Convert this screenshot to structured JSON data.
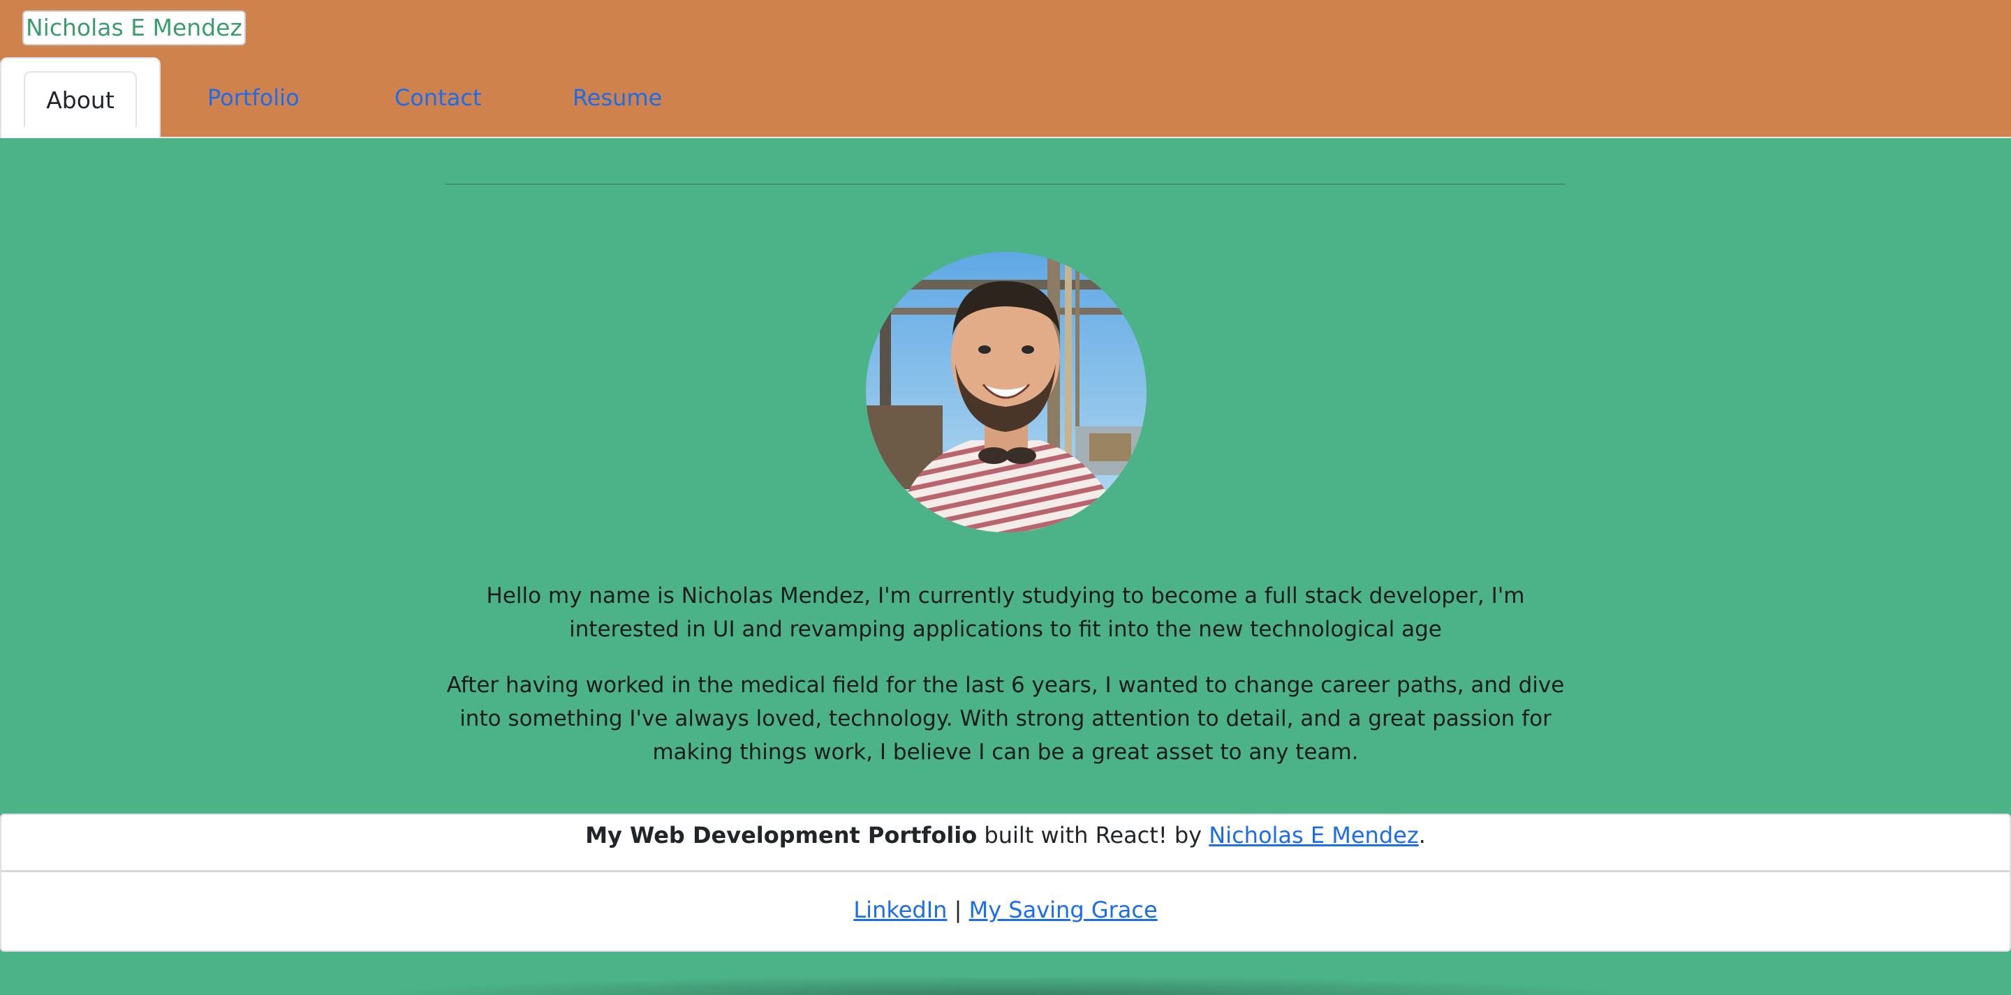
{
  "header": {
    "brand": "Nicholas E Mendez",
    "tabs": [
      {
        "label": "About",
        "active": true
      },
      {
        "label": "Portfolio",
        "active": false
      },
      {
        "label": "Contact",
        "active": false
      },
      {
        "label": "Resume",
        "active": false
      }
    ]
  },
  "about": {
    "paragraph_1": "Hello my name is Nicholas Mendez, I'm currently studying to become a full stack developer, I'm interested in UI and revamping applications to fit into the new technological age",
    "paragraph_2": "After having worked in the medical field for the last 6 years, I wanted to change career paths, and dive into something I've always loved, technology. With strong attention to detail, and a great passion for making things work, I believe I can be a great asset to any team."
  },
  "footer": {
    "credit_bold": "My Web Development Portfolio",
    "credit_middle": " built with React! by ",
    "credit_link": "Nicholas E Mendez",
    "credit_end": ".",
    "link_1": "LinkedIn",
    "separator": " | ",
    "link_2": "My Saving Grace"
  },
  "colors": {
    "header_bg": "#cf824b",
    "page_bg": "#4cb388",
    "link": "#1a6cf0",
    "brand_text": "#3a9d70"
  }
}
